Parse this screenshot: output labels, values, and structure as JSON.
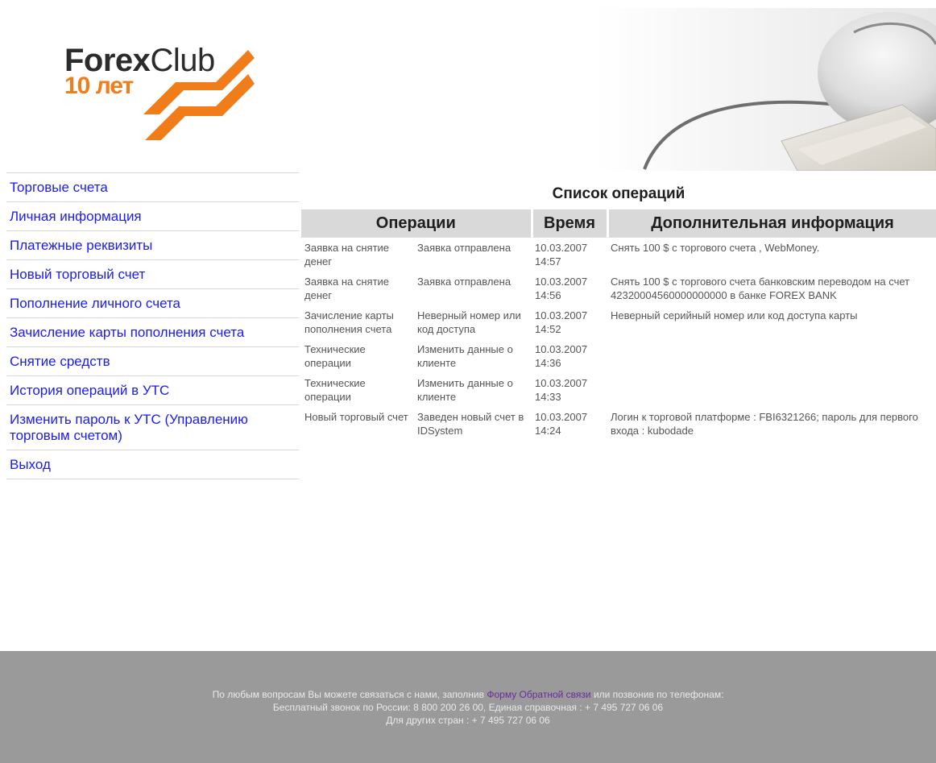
{
  "logo": {
    "brand_part1": "Forex",
    "brand_part2": "Club",
    "subtitle": "10 лет",
    "brand_color": "#f07d1a"
  },
  "sidebar": {
    "items": [
      {
        "label": "Торговые счета"
      },
      {
        "label": "Личная информация"
      },
      {
        "label": "Платежные реквизиты"
      },
      {
        "label": "Новый торговый счет"
      },
      {
        "label": "Пополнение личного счета"
      },
      {
        "label": "Зачисление карты пополнения счета"
      },
      {
        "label": "Снятие средств"
      },
      {
        "label": "История операций в УТС"
      },
      {
        "label": "Изменить пароль к УТС (Управлению торговым счетом)"
      },
      {
        "label": "Выход"
      }
    ]
  },
  "main": {
    "title": "Список операций",
    "columns": {
      "operations": "Операции",
      "time": "Время",
      "info": "Дополнительная информация"
    },
    "rows": [
      {
        "type": "Заявка на снятие денег",
        "status": "Заявка отправлена",
        "date": "10.03.2007",
        "time": "14:57",
        "info": "Снять 100 $ с торгового счета , WebMoney."
      },
      {
        "type": "Заявка на снятие денег",
        "status": "Заявка отправлена",
        "date": "10.03.2007",
        "time": "14:56",
        "info": "Снять 100 $ с торгового счета банковским переводом на счет 42320004560000000000 в банке FOREX BANK"
      },
      {
        "type": "Зачисление карты пополнения счета",
        "status": "Неверный номер или код доступа",
        "date": "10.03.2007",
        "time": "14:52",
        "info": "Неверный серийный номер или код доступа карты"
      },
      {
        "type": "Технические операции",
        "status": "Изменить данные о клиенте",
        "date": "10.03.2007",
        "time": "14:36",
        "info": ""
      },
      {
        "type": "Технические операции",
        "status": "Изменить данные о клиенте",
        "date": "10.03.2007",
        "time": "14:33",
        "info": ""
      },
      {
        "type": "Новый торговый счет",
        "status": "Заведен новый счет в IDSystem",
        "date": "10.03.2007",
        "time": "14:24",
        "info": "Логин к торговой платформе : FBI6321266; пароль для первого входа : kubodade"
      }
    ]
  },
  "footer": {
    "line1_before": "По любым вопросам Вы можете связаться с нами, заполнив ",
    "link_text": "Форму Обратной связи",
    "line1_after": " или позвонив по телефонам:",
    "line2": "Бесплатный звонок по России: 8 800 200 26 00, Единая справочная : + 7 495 727 06 06",
    "line3": "Для других стран : + 7 495 727 06 06"
  }
}
